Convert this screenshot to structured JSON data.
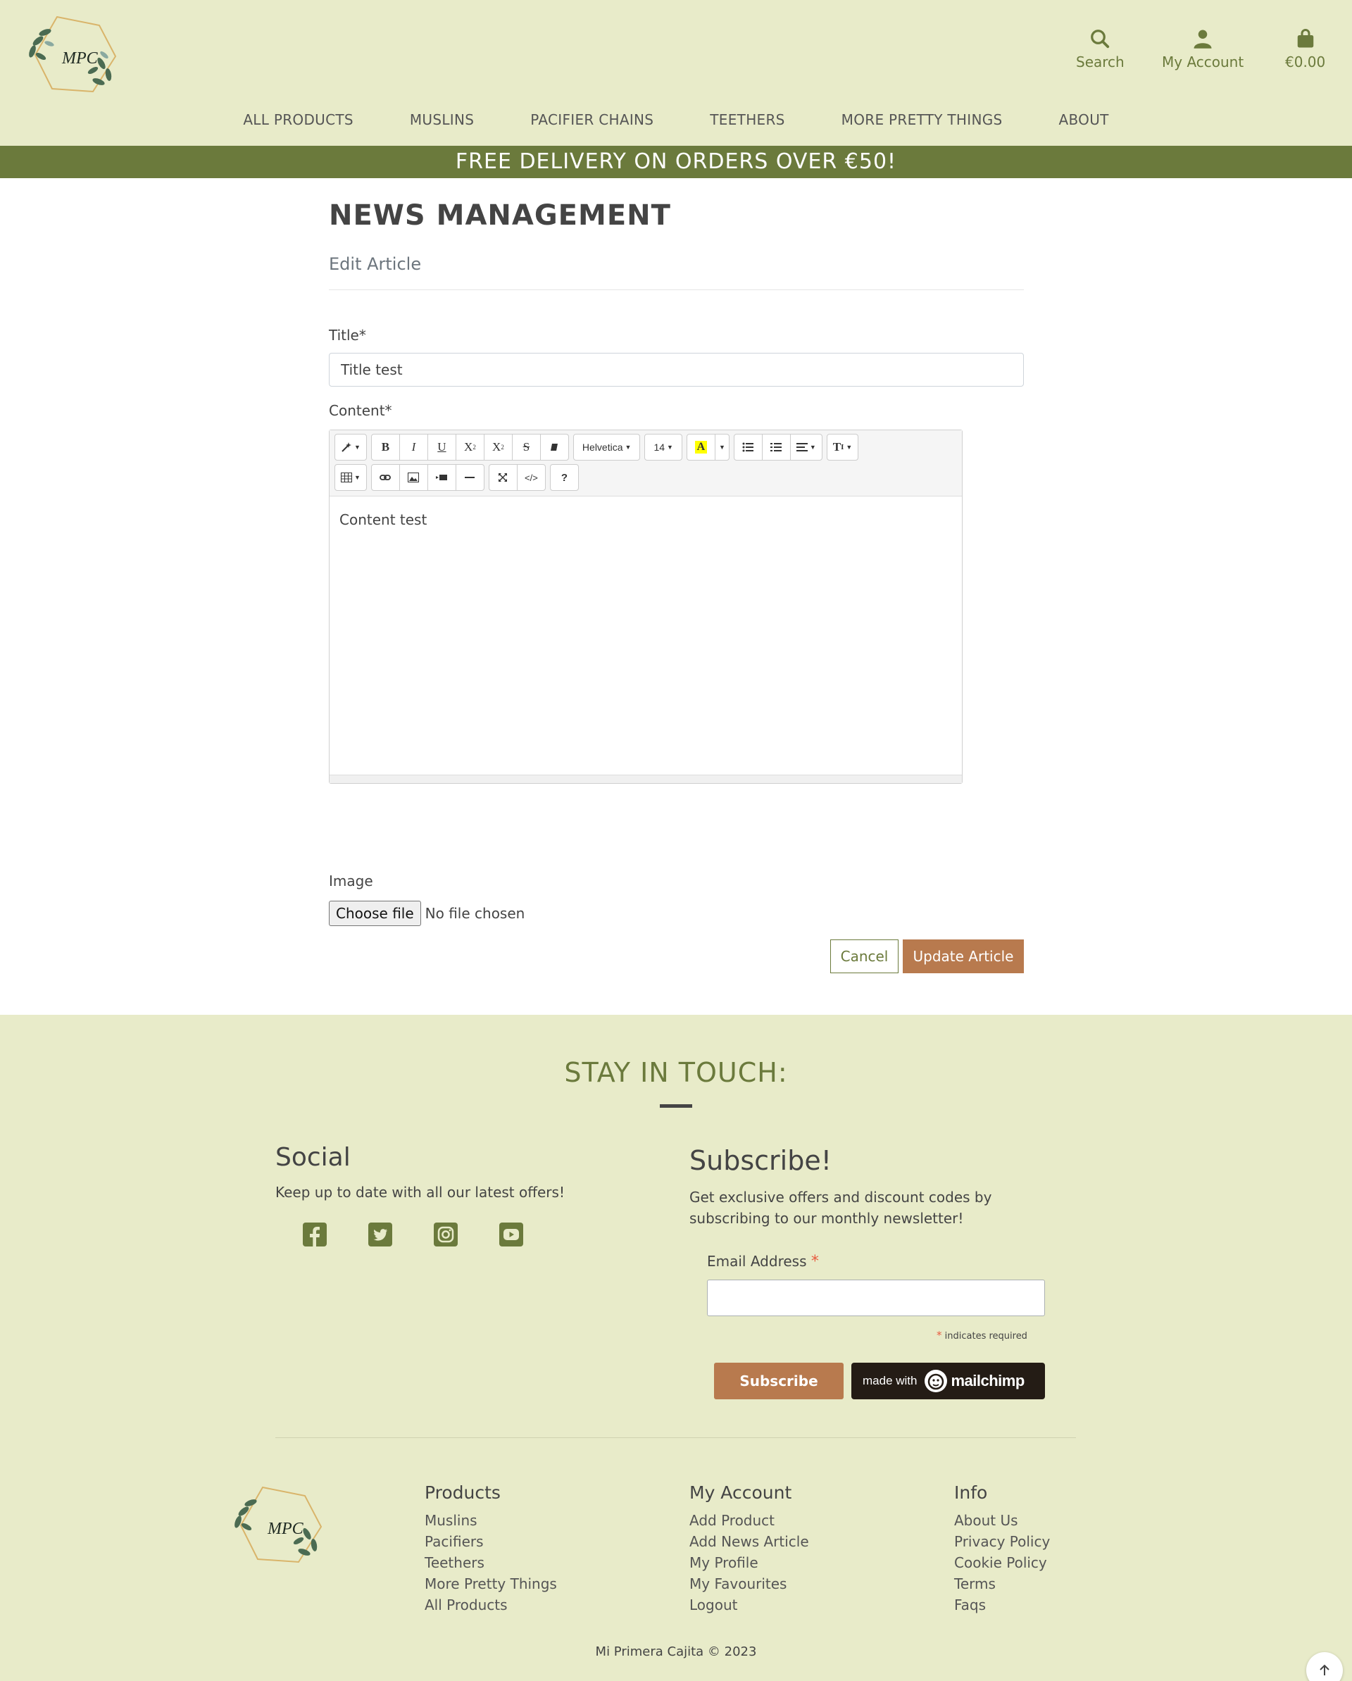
{
  "header": {
    "icons": {
      "search_label": "Search",
      "account_label": "My Account",
      "cart_total": "€0.00"
    },
    "nav": [
      "All Products",
      "Muslins",
      "Pacifier Chains",
      "Teethers",
      "More Pretty Things",
      "About"
    ],
    "banner": "FREE DELIVERY ON ORDERS OVER €50!",
    "logo_letters": "MPC",
    "brand_color": "#6b7a3c",
    "background_color": "#e8ebc9"
  },
  "main": {
    "title": "NEWS MANAGEMENT",
    "subtitle": "Edit Article",
    "title_label": "Title*",
    "title_value": "Title test",
    "content_label": "Content*",
    "toolbar": {
      "font_name": "Helvetica",
      "font_size": "14",
      "help_label": "?",
      "code_label": "</>",
      "style_label": "T"
    },
    "content_value": "Content test",
    "image_label": "Image",
    "file_button": "Choose file",
    "file_status": "No file chosen",
    "cancel_label": "Cancel",
    "update_label": "Update Article",
    "accent_color": "#b87a4e"
  },
  "footer": {
    "stay_title": "STAY IN TOUCH:",
    "social_heading": "Social",
    "social_text": "Keep up to date with all our latest offers!",
    "social_icons": [
      "facebook-icon",
      "twitter-icon",
      "instagram-icon",
      "youtube-icon"
    ],
    "subscribe_heading": "Subscribe!",
    "subscribe_text": "Get exclusive offers and discount codes by subscribing to our monthly newsletter!",
    "email_label": "Email Address",
    "required_star": "*",
    "required_note": "indicates required",
    "subscribe_button": "Subscribe",
    "mailchimp_small": "made with",
    "mailchimp_word": "mailchimp",
    "columns": {
      "products": {
        "heading": "Products",
        "links": [
          "Muslins",
          "Pacifiers",
          "Teethers",
          "More Pretty Things",
          "All Products"
        ]
      },
      "account": {
        "heading": "My Account",
        "links": [
          "Add Product",
          "Add News Article",
          "My Profile",
          "My Favourites",
          "Logout"
        ]
      },
      "info": {
        "heading": "Info",
        "links": [
          "About Us",
          "Privacy Policy",
          "Cookie Policy",
          "Terms",
          "Faqs"
        ]
      }
    },
    "copyright": "Mi Primera Cajita © 2023"
  }
}
